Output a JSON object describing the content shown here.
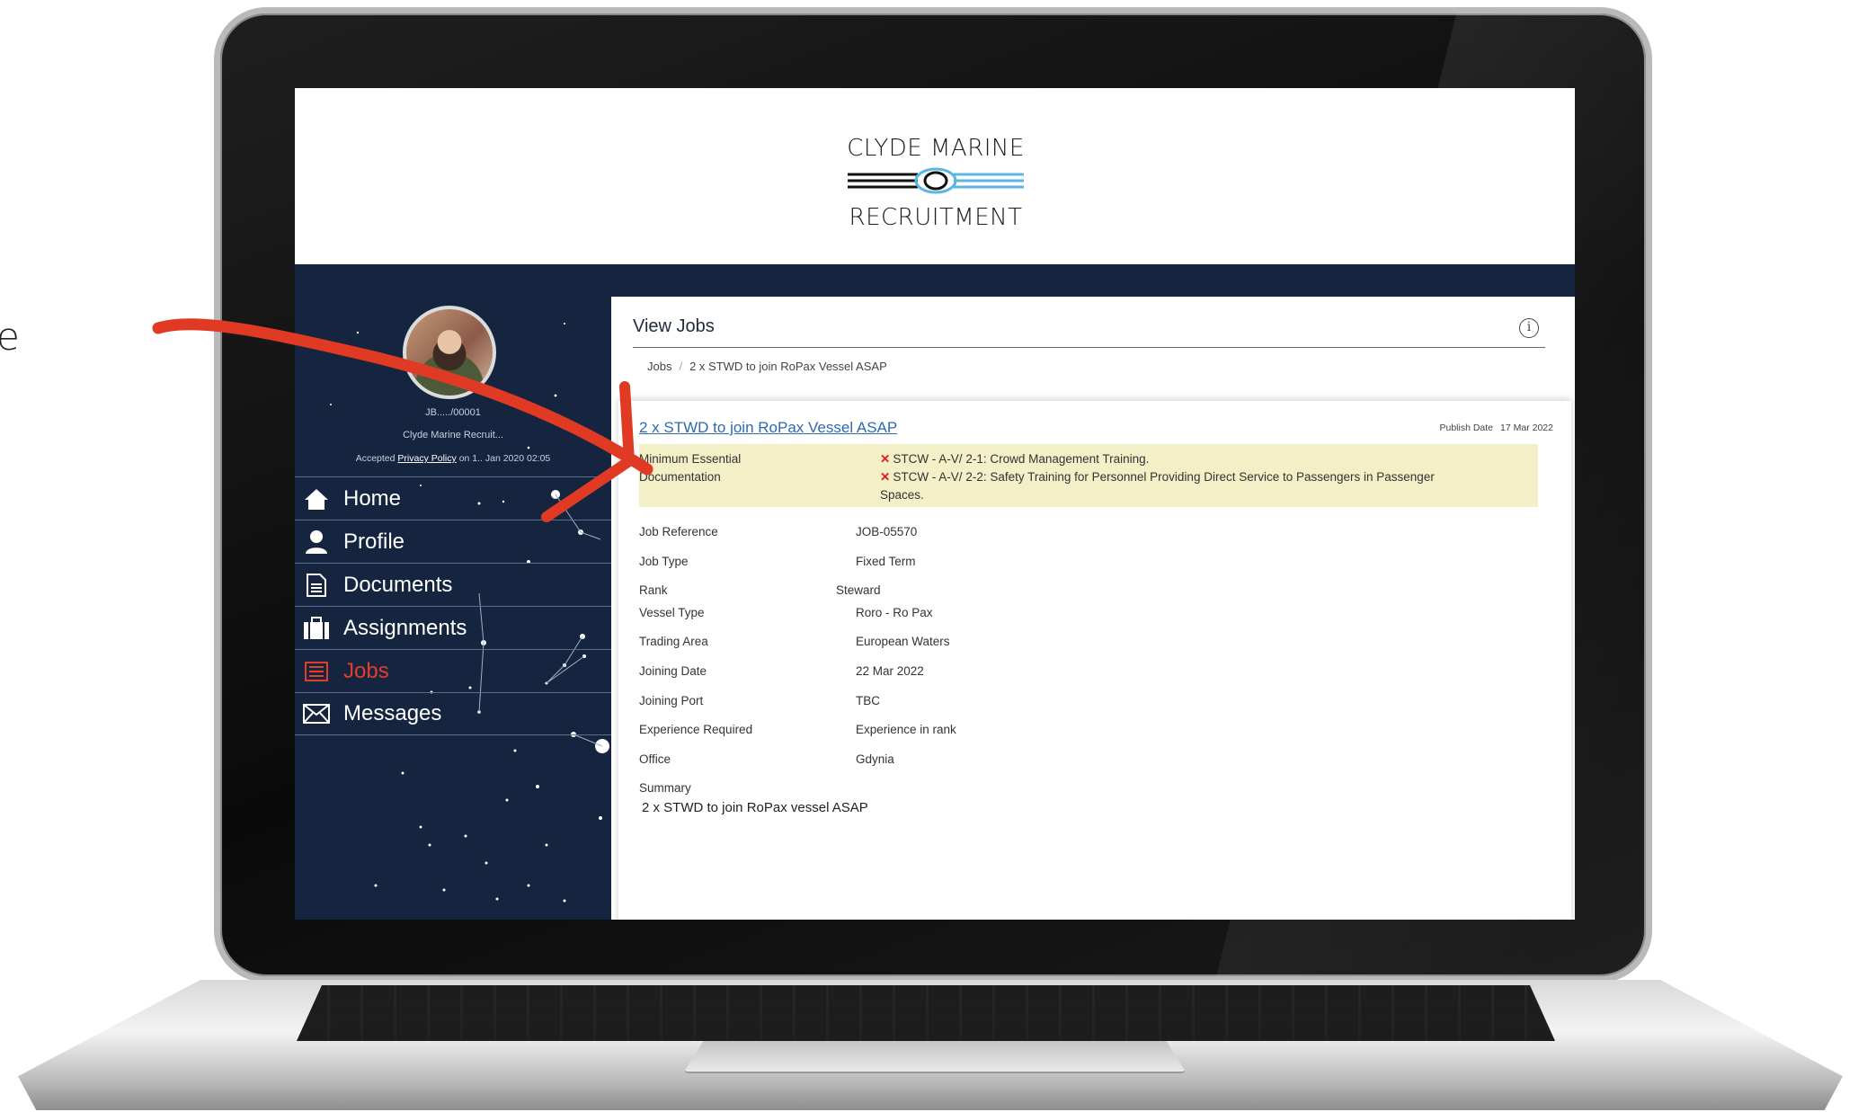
{
  "edge_text": "e",
  "brand": {
    "line1": "CLYDE MARINE",
    "line2": "RECRUITMENT"
  },
  "user": {
    "id": "JB...../00001",
    "company": "Clyde Marine Recruit...",
    "accepted_prefix": "Accepted",
    "privacy_link": "Privacy Policy",
    "accepted_suffix": "on 1.. Jan 2020 02:05"
  },
  "nav": [
    {
      "label": "Home",
      "icon": "home-icon",
      "active": false
    },
    {
      "label": "Profile",
      "icon": "user-icon",
      "active": false
    },
    {
      "label": "Documents",
      "icon": "document-icon",
      "active": false
    },
    {
      "label": "Assignments",
      "icon": "briefcase-icon",
      "active": false
    },
    {
      "label": "Jobs",
      "icon": "jobs-icon",
      "active": true
    },
    {
      "label": "Messages",
      "icon": "envelope-icon",
      "active": false
    }
  ],
  "page": {
    "title": "View Jobs",
    "breadcrumb": [
      "Jobs",
      "2 x STWD to join RoPax Vessel ASAP"
    ]
  },
  "job": {
    "title": "2 x STWD to join RoPax Vessel ASAP",
    "publish_label": "Publish Date",
    "publish_date": "17 Mar 2022",
    "docs_label_1": "Minimum Essential",
    "docs_label_2": "Documentation",
    "docs": [
      "STCW - A-V/ 2-1: Crowd Management Training.",
      "STCW - A-V/ 2-2: Safety Training for Personnel Providing Direct Service to Passengers in Passenger",
      "Spaces."
    ],
    "fields": [
      {
        "label": "Job Reference",
        "value": "JOB-05570"
      },
      {
        "label": "Job Type",
        "value": "Fixed Term"
      },
      {
        "label": "Rank",
        "value": "Steward"
      },
      {
        "label": "Vessel Type",
        "value": "Roro - Ro Pax"
      },
      {
        "label": "Trading Area",
        "value": "European Waters"
      },
      {
        "label": "Joining Date",
        "value": "22 Mar 2022"
      },
      {
        "label": "Joining Port",
        "value": "TBC"
      },
      {
        "label": "Experience Required",
        "value": "Experience in rank"
      },
      {
        "label": "Office",
        "value": "Gdynia"
      }
    ],
    "summary_label": "Summary",
    "summary": "2 x STWD to join RoPax vessel ASAP"
  },
  "colors": {
    "navy": "#16253f",
    "accent_red": "#e63d2a",
    "link_blue": "#2c6ab3",
    "highlight": "#f3efc7"
  }
}
